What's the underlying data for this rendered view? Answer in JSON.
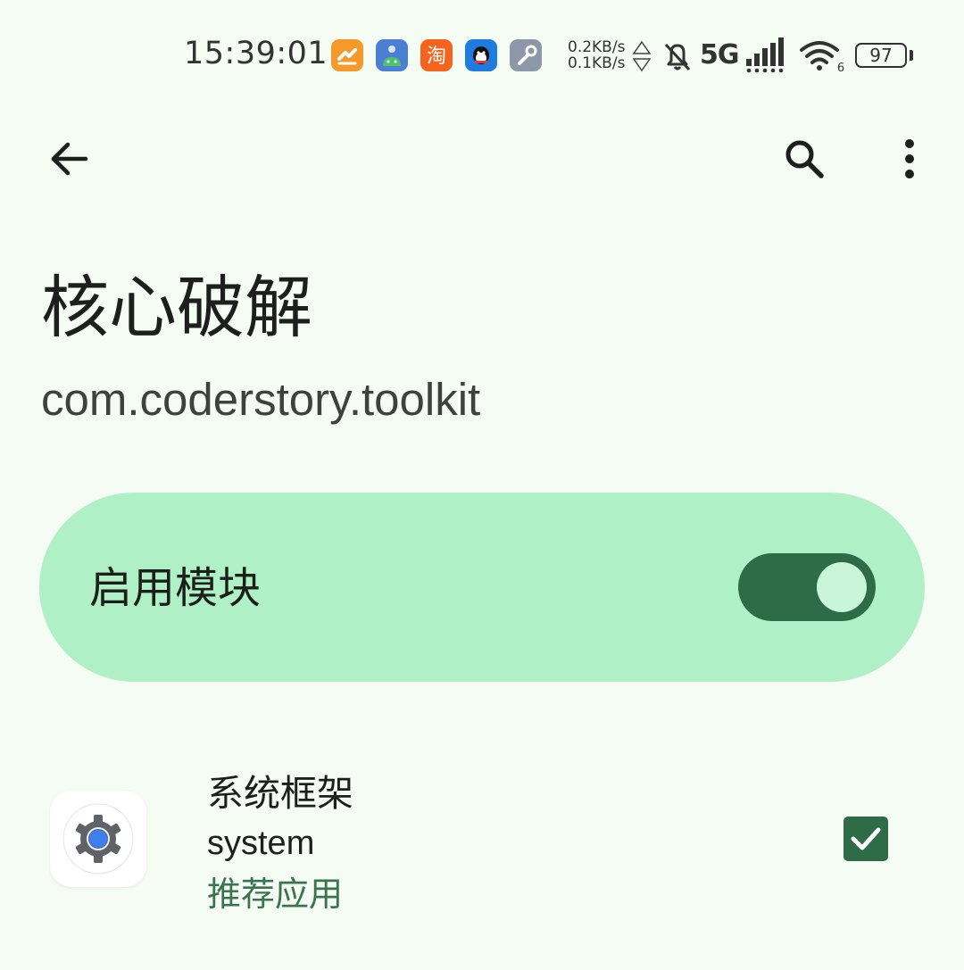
{
  "status_bar": {
    "time": "15:39:01",
    "notification_icons": [
      "app-orange-icon",
      "android-debug-icon",
      "taobao-icon",
      "qq-icon",
      "wrench-tool-icon"
    ],
    "taobao_glyph": "淘",
    "net_up": "0.2KB/s",
    "net_down": "0.1KB/s",
    "network": "5G",
    "wifi_band": "6",
    "battery": "97"
  },
  "toolbar": {
    "back_icon": "arrow-back-icon",
    "search_icon": "search-icon",
    "menu_icon": "more-vert-icon"
  },
  "module": {
    "title": "核心破解",
    "package": "com.coderstory.toolkit"
  },
  "enable_card": {
    "label": "启用模块",
    "enabled": true,
    "accent_color": "#2e6b47",
    "card_color": "#b0f0c6"
  },
  "scope_list": [
    {
      "name": "系统框架",
      "package": "system",
      "tag": "推荐应用",
      "checked": true,
      "icon": "settings-gear-icon"
    }
  ]
}
